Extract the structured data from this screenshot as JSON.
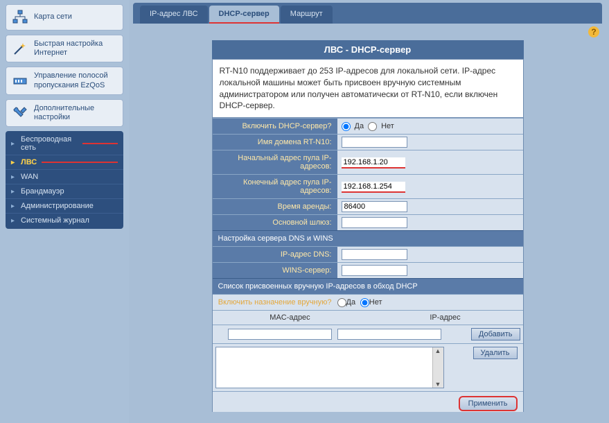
{
  "sidebar": {
    "items": [
      {
        "label": "Карта сети"
      },
      {
        "label": "Быстрая настройка Интернет"
      },
      {
        "label": "Управление полосой пропускания EzQoS"
      },
      {
        "label": "Дополнительные настройки"
      }
    ],
    "sub": [
      {
        "label": "Беспроводная сеть"
      },
      {
        "label": "ЛВС"
      },
      {
        "label": "WAN"
      },
      {
        "label": "Брандмауэр"
      },
      {
        "label": "Администрирование"
      },
      {
        "label": "Системный журнал"
      }
    ]
  },
  "tabs": [
    {
      "label": "IP-адрес ЛВС"
    },
    {
      "label": "DHCP-сервер"
    },
    {
      "label": "Маршрут"
    }
  ],
  "panel": {
    "title": "ЛВС - DHCP-сервер",
    "desc": "RT-N10 поддерживает до 253 IP-адресов для локальной сети. IP-адрес локальной машины может быть присвоен вручную системным администратором или получен автоматически от RT-N10, если включен DHCP-сервер."
  },
  "fields": {
    "enable_label": "Включить DHCP-сервер?",
    "yes": "Да",
    "no": "Нет",
    "domain_label": "Имя домена RT-N10:",
    "domain_val": "",
    "start_label": "Начальный адрес пула IP-адресов:",
    "start_val": "192.168.1.20",
    "end_label": "Конечный адрес пула IP-адресов:",
    "end_val": "192.168.1.254",
    "lease_label": "Время аренды:",
    "lease_val": "86400",
    "gateway_label": "Основной шлюз:",
    "gateway_val": ""
  },
  "dns_section": {
    "head": "Настройка сервера DNS и WINS",
    "dns_label": "IP-адрес DNS:",
    "dns_val": "",
    "wins_label": "WINS-сервер:",
    "wins_val": ""
  },
  "manual": {
    "head": "Список присвоенных вручную IP-адресов в обход DHCP",
    "enable_label": "Включить назначение вручную?",
    "yes": "Да",
    "no": "Нет",
    "col_mac": "MAC-адрес",
    "col_ip": "IP-адрес",
    "add": "Добавить",
    "del": "Удалить"
  },
  "apply": "Применить",
  "help": "?"
}
